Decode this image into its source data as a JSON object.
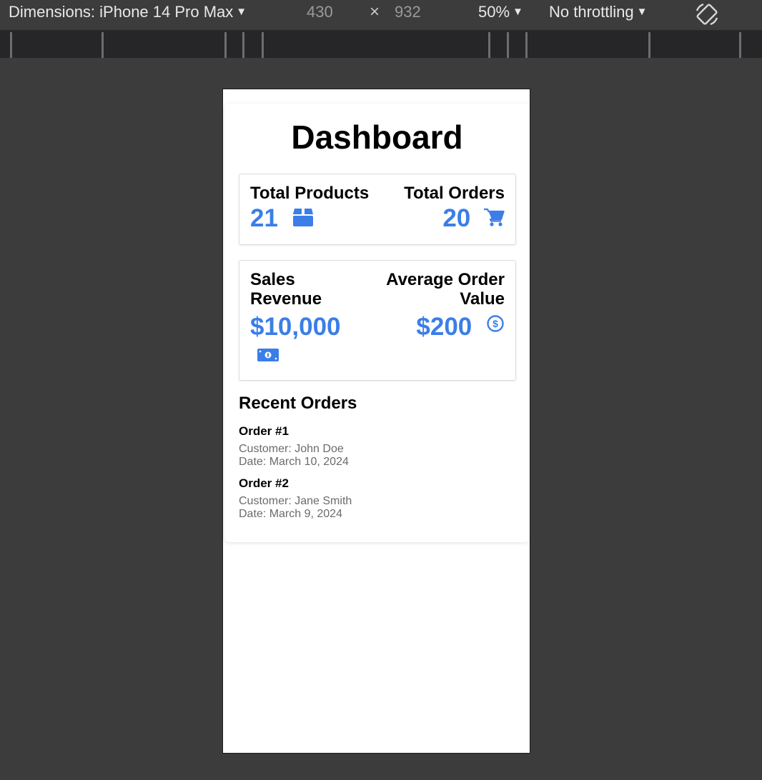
{
  "devtools": {
    "dimensions_label": "Dimensions: iPhone 14 Pro Max",
    "width": "430",
    "times": "×",
    "height": "932",
    "zoom": "50%",
    "throttling": "No throttling",
    "rotate_icon": "rotate-icon"
  },
  "dashboard": {
    "title": "Dashboard",
    "stats": {
      "total_products": {
        "label": "Total Products",
        "value": "21",
        "icon": "box-icon"
      },
      "total_orders": {
        "label": "Total Orders",
        "value": "20",
        "icon": "cart-icon"
      },
      "sales_revenue": {
        "label": "Sales Revenue",
        "value": "$10,000",
        "icon": "money-bill-icon"
      },
      "average_order_value": {
        "label": "Average Order Value",
        "value": "$200",
        "icon": "dollar-circle-icon"
      }
    },
    "accent_color": "#3b7ee8",
    "recent_orders": {
      "title": "Recent Orders",
      "orders": [
        {
          "title": "Order #1",
          "customer": "Customer: John Doe",
          "date": "Date: March 10, 2024"
        },
        {
          "title": "Order #2",
          "customer": "Customer: Jane Smith",
          "date": "Date: March 9, 2024"
        }
      ]
    }
  }
}
